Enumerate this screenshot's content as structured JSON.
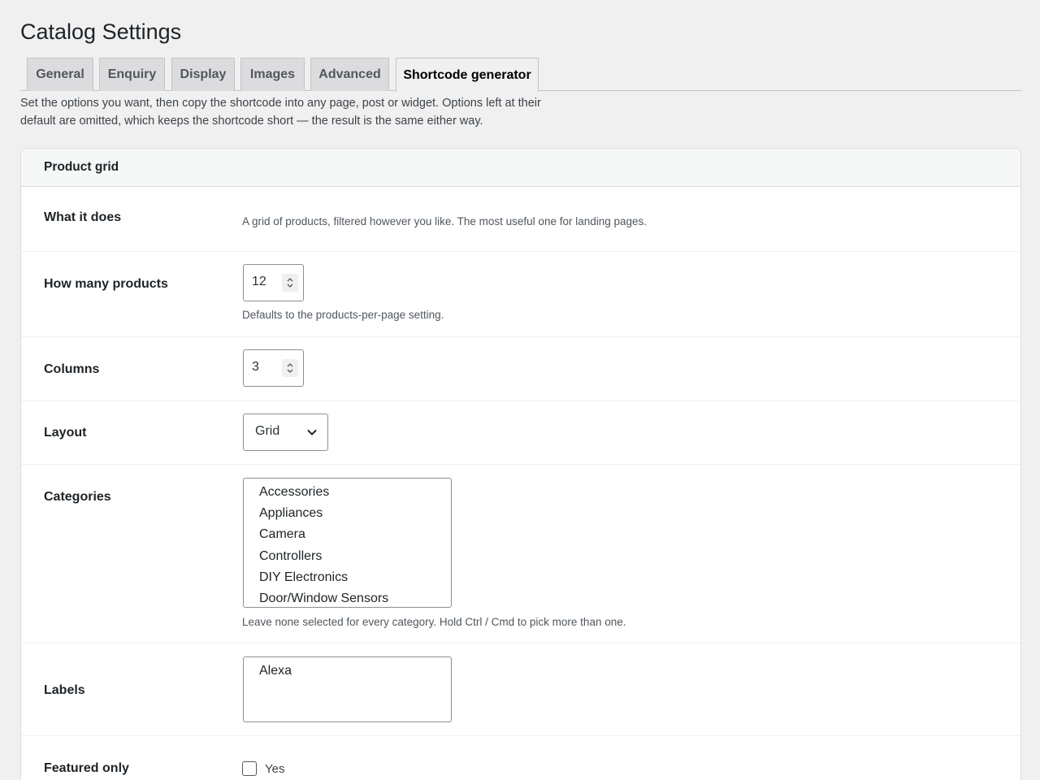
{
  "page": {
    "title": "Catalog Settings",
    "intro": "Set the options you want, then copy the shortcode into any page, post or widget. Options left at their default are omitted, which keeps the shortcode short — the result is the same either way."
  },
  "tabs": [
    {
      "label": "General"
    },
    {
      "label": "Enquiry"
    },
    {
      "label": "Display"
    },
    {
      "label": "Images"
    },
    {
      "label": "Advanced"
    },
    {
      "label": "Shortcode generator",
      "active": true
    }
  ],
  "card": {
    "title": "Product grid",
    "what_it_does": {
      "label": "What it does",
      "text": "A grid of products, filtered however you like. The most useful one for landing pages."
    },
    "how_many": {
      "label": "How many products",
      "value": "12",
      "help": "Defaults to the products-per-page setting."
    },
    "columns": {
      "label": "Columns",
      "value": "3"
    },
    "layout": {
      "label": "Layout",
      "value": "Grid"
    },
    "categories": {
      "label": "Categories",
      "options": [
        "Accessories",
        "Appliances",
        "Camera",
        "Controllers",
        "DIY Electronics",
        "Door/Window Sensors"
      ],
      "help": "Leave none selected for every category. Hold Ctrl / Cmd to pick more than one."
    },
    "labels": {
      "label": "Labels",
      "options": [
        "Alexa"
      ]
    },
    "featured": {
      "label": "Featured only",
      "checkbox_label": "Yes",
      "checked": false
    }
  },
  "icons": {
    "spinner": "up-down-arrows-icon",
    "select": "chevron-down-icon"
  }
}
